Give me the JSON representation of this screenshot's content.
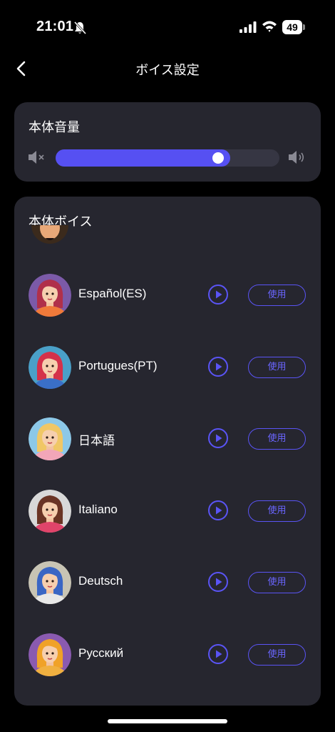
{
  "status_bar": {
    "time": "21:01",
    "battery": "49"
  },
  "header": {
    "title": "ボイス設定"
  },
  "volume": {
    "title": "本体音量",
    "level": 0.78
  },
  "voices": {
    "title": "本体ボイス",
    "use_label": "使用",
    "items": [
      {
        "label": "Español(ES)",
        "hair": "#b0304a",
        "bg": "#7b5aa8",
        "top": "#f07a3a"
      },
      {
        "label": "Portugues(PT)",
        "hair": "#d4314a",
        "bg": "#4aa0c8",
        "top": "#3a6fc8"
      },
      {
        "label": "日本語",
        "hair": "#f0c766",
        "bg": "#8cc8e8",
        "top": "#f2a6b8"
      },
      {
        "label": "Italiano",
        "hair": "#6a3424",
        "bg": "#d8d8d8",
        "top": "#e0446a"
      },
      {
        "label": "Deutsch",
        "hair": "#3a66c4",
        "bg": "#c8c4b4",
        "top": "#e8e8e8"
      },
      {
        "label": "Русский",
        "hair": "#f0a228",
        "bg": "#8a5ab0",
        "top": "#f0b040"
      }
    ]
  }
}
